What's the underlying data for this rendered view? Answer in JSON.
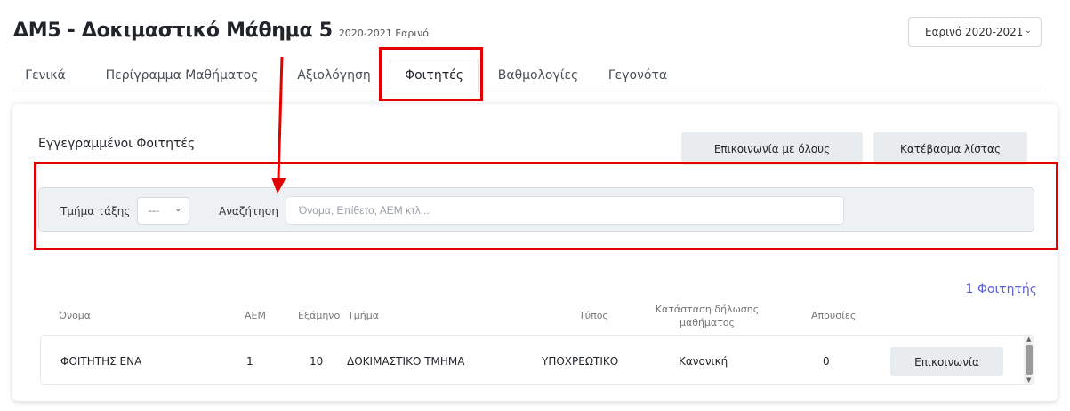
{
  "header": {
    "title": "ΔΜ5 - Δοκιμαστικό Μάθημα 5",
    "subtitle": "2020-2021 Εαρινό",
    "semester_selected": "Εαρινό 2020-2021"
  },
  "tabs": [
    {
      "label": "Γενικά"
    },
    {
      "label": "Περίγραμμα Μαθήματος"
    },
    {
      "label": "Αξιολόγηση"
    },
    {
      "label": "Φοιτητές"
    },
    {
      "label": "Βαθμολογίες"
    },
    {
      "label": "Γεγονότα"
    }
  ],
  "students": {
    "title": "Εγγεγραμμένοι Φοιτητές",
    "contact_all_label": "Επικοινωνία με όλους",
    "download_label": "Κατέβασμα λίστας",
    "filter": {
      "section_label": "Τμήμα τάξης",
      "section_value": "---",
      "search_label": "Αναζήτηση",
      "search_placeholder": "Όνομα, Επίθετο, ΑΕΜ κτλ..."
    },
    "count_label": "1 Φοιτητής",
    "columns": {
      "name": "Όνομα",
      "aem": "ΑΕΜ",
      "semester": "Εξάμηνο",
      "section": "Τμήμα",
      "type": "Τύπος",
      "status_line1": "Κατάσταση δήλωσης",
      "status_line2": "μαθήματος",
      "absences": "Απουσίες"
    },
    "rows": [
      {
        "name": "ΦΟΙΤΗΤΗΣ ΕΝΑ",
        "aem": "1",
        "semester": "10",
        "section": "ΔΟΚΙΜΑΣΤΙΚΟ ΤΜΗΜΑ",
        "type": "ΥΠΟΧΡΕΩΤΙΚΟ",
        "status": "Κανονική",
        "absences": "0",
        "action": "Επικοινωνία"
      }
    ]
  },
  "colors": {
    "annotation": "#e30000",
    "count": "#5a5fd8"
  }
}
